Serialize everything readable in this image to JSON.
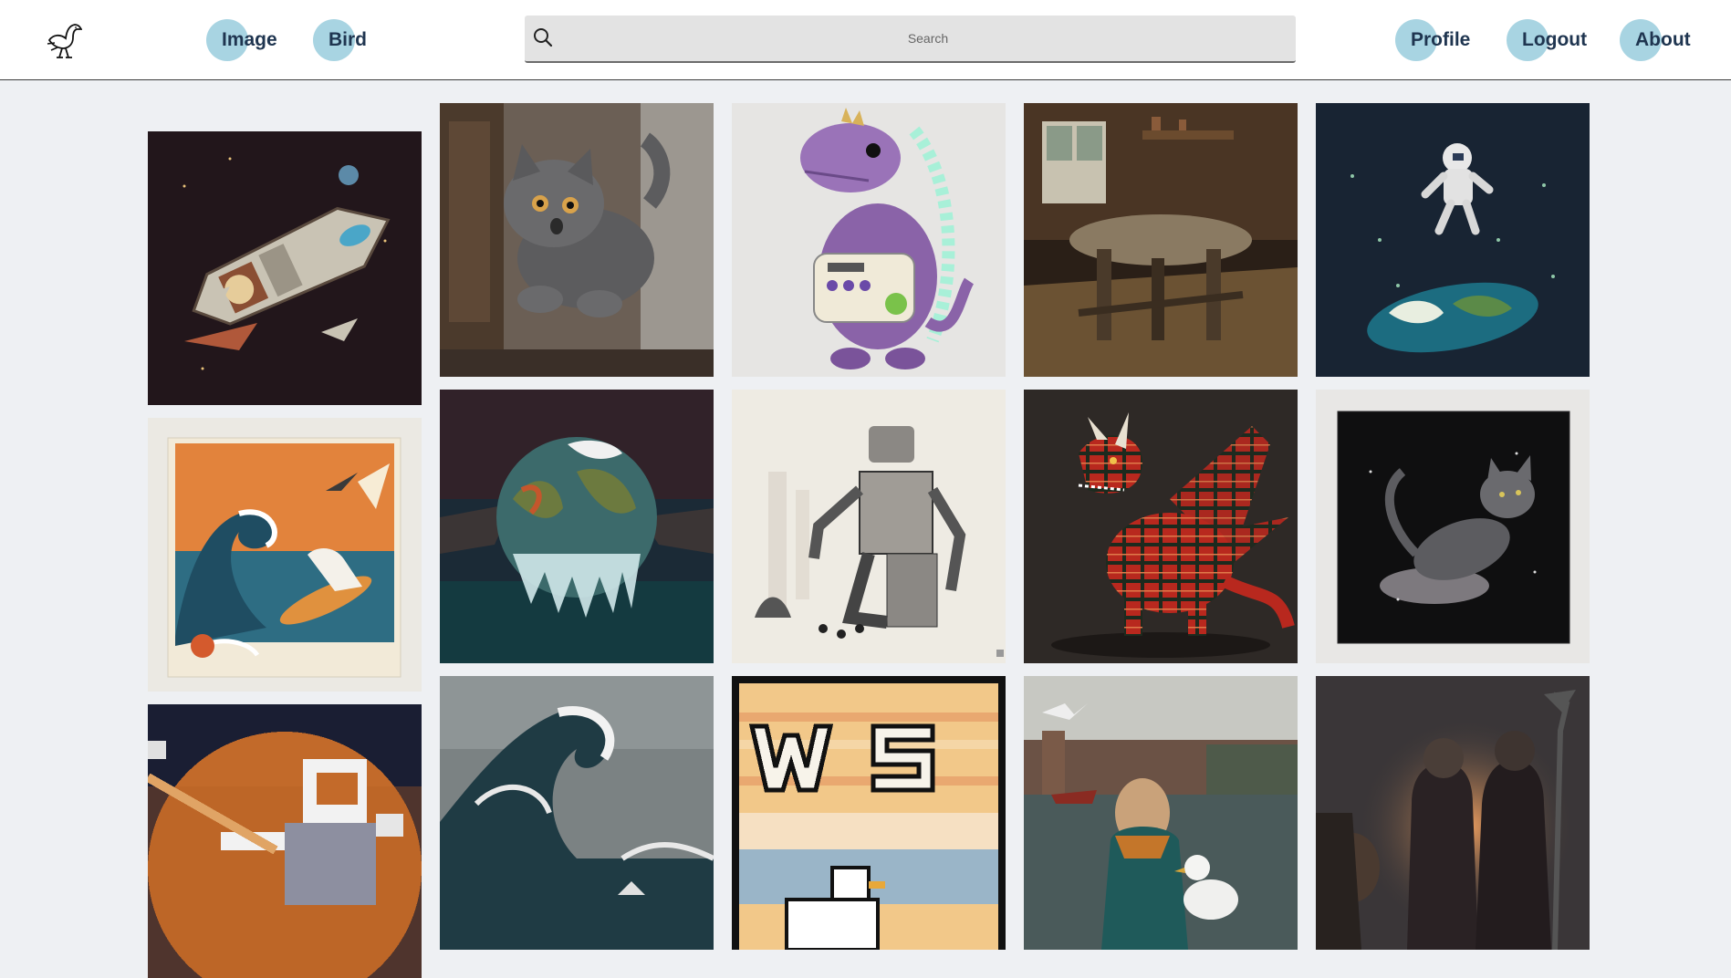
{
  "header": {
    "nav_left": [
      {
        "label": "Image"
      },
      {
        "label": "Bird"
      }
    ],
    "search": {
      "placeholder": "Search"
    },
    "nav_right": [
      {
        "label": "Profile"
      },
      {
        "label": "Logout"
      },
      {
        "label": "About"
      }
    ]
  },
  "gallery": {
    "images": [
      {
        "name": "spaceship"
      },
      {
        "name": "gray-cat-leaping"
      },
      {
        "name": "purple-dinosaur-synth"
      },
      {
        "name": "cabin-table"
      },
      {
        "name": "astronaut-earth"
      },
      {
        "name": "wave-seagull-surfing"
      },
      {
        "name": "melting-earth"
      },
      {
        "name": "robot-ink"
      },
      {
        "name": "plaid-dragon"
      },
      {
        "name": "space-cat-canvas"
      },
      {
        "name": "pixel-astronaut"
      },
      {
        "name": "great-wave"
      },
      {
        "name": "pixel-ws-seagull"
      },
      {
        "name": "girl-seagull-harbor"
      },
      {
        "name": "warriors-sunset"
      }
    ]
  }
}
